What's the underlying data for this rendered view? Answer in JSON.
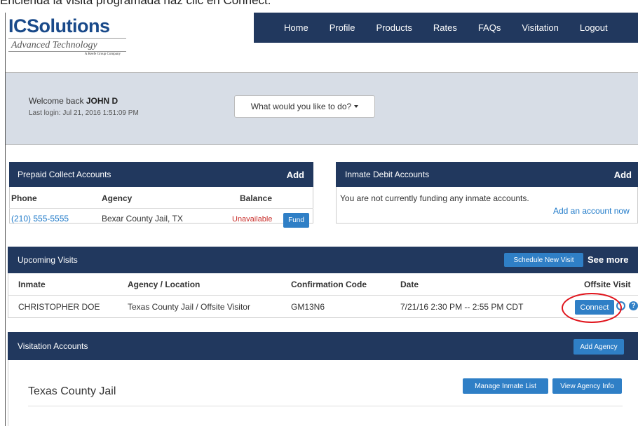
{
  "caption": "Encienda la visita programada haz clic en Connect.",
  "logo": {
    "brand_prefix": "IC",
    "brand_suffix": "Solutions",
    "tagline": "Advanced Technology",
    "subtagline": "A Keefe Group Company"
  },
  "nav": {
    "items": [
      "Home",
      "Profile",
      "Products",
      "Rates",
      "FAQs",
      "Visitation",
      "Logout"
    ]
  },
  "welcome": {
    "greeting": "Welcome back",
    "user": "JOHN D",
    "last_login": "Last login: Jul 21, 2016 1:51:09 PM",
    "dropdown_label": "What would you like to do?"
  },
  "prepaid": {
    "title": "Prepaid Collect Accounts",
    "add_label": "Add",
    "columns": [
      "Phone",
      "Agency",
      "Balance"
    ],
    "rows": [
      {
        "phone": "(210) 555-5555",
        "agency": "Bexar County Jail, TX",
        "balance": "Unavailable",
        "action": "Fund"
      }
    ]
  },
  "debit": {
    "title": "Inmate Debit Accounts",
    "add_label": "Add",
    "empty_message": "You are not currently funding any inmate accounts.",
    "add_account_link": "Add an account now"
  },
  "visits": {
    "title": "Upcoming Visits",
    "schedule_label": "Schedule New Visit",
    "see_more_label": "See more",
    "columns": [
      "Inmate",
      "Agency / Location",
      "Confirmation Code",
      "Date",
      "Offsite Visit"
    ],
    "rows": [
      {
        "inmate": "CHRISTOPHER DOE",
        "agency": "Texas County Jail / Offsite Visitor",
        "code": "GM13N6",
        "date": "7/21/16 2:30 PM -- 2:55 PM CDT",
        "action": "Connect"
      }
    ]
  },
  "visitation_accounts": {
    "title": "Visitation Accounts",
    "add_agency_label": "Add Agency",
    "agencies": [
      {
        "name": "Texas County Jail",
        "manage_label": "Manage Inmate List",
        "info_label": "View Agency Info"
      }
    ]
  },
  "colors": {
    "navy": "#21385e",
    "button_blue": "#2f7fc6",
    "link_blue": "#1f7ac9",
    "unavailable_red": "#c9302c",
    "highlight_red": "#e0141c"
  }
}
